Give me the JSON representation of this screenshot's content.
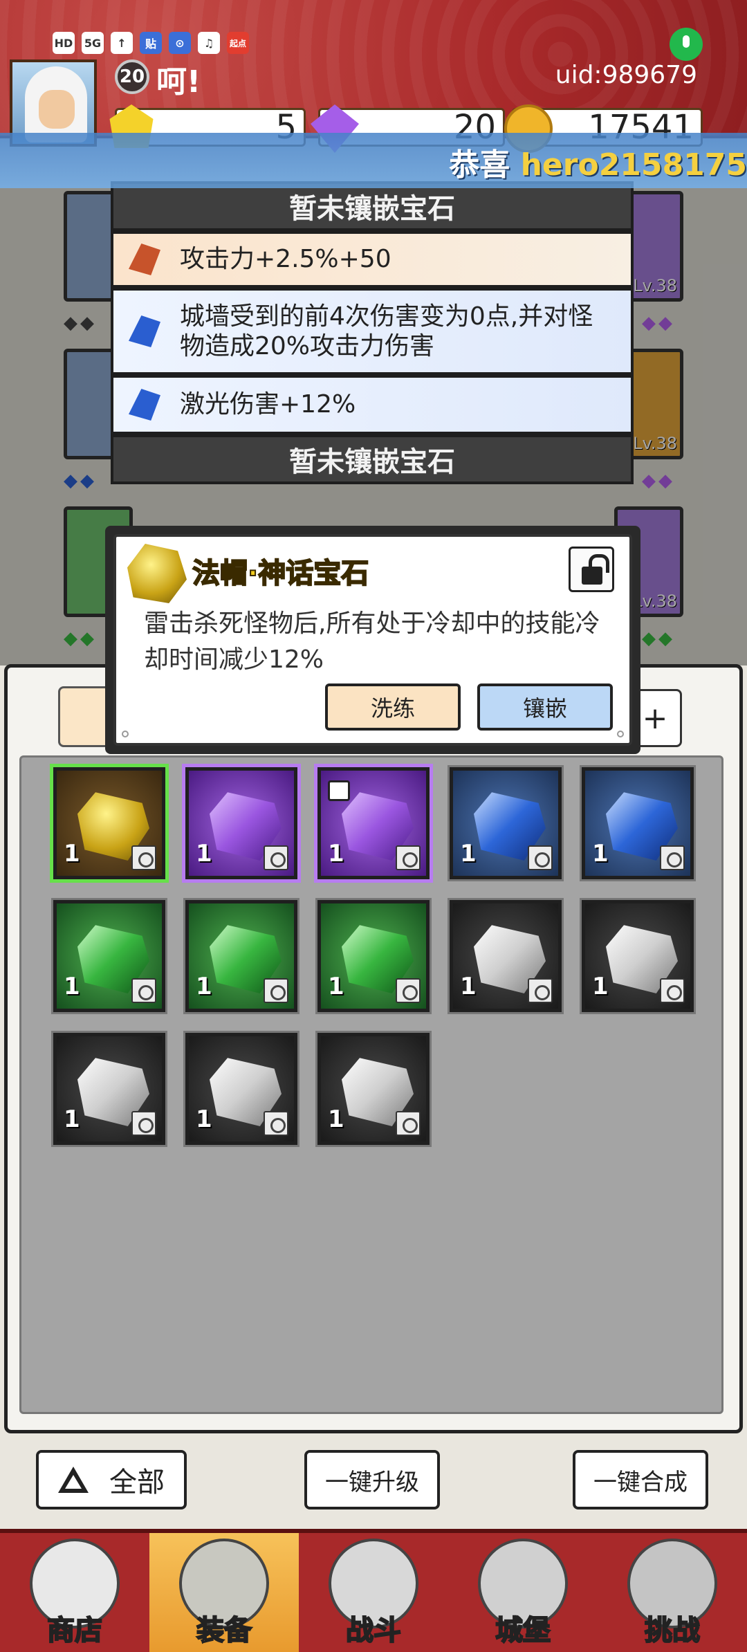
{
  "header": {
    "level": "20",
    "player_name": "呵!",
    "uid": "uid:989679",
    "status_icons": [
      "HD",
      "5G",
      "↑",
      "贴",
      "⊙",
      "♫",
      "起点"
    ],
    "resources": [
      {
        "icon": "yellow-gem-icon",
        "value": "5"
      },
      {
        "icon": "purple-diamond-icon",
        "value": "20"
      },
      {
        "icon": "gold-coin-icon",
        "value": "17541"
      }
    ]
  },
  "banner": {
    "prefix": "恭喜 ",
    "highlight": "hero2158175"
  },
  "equipment_bg": {
    "levels": [
      "Lv.38",
      "Lv.38",
      "Lv.38"
    ]
  },
  "gem_slots": [
    {
      "type": "empty",
      "label": "暂未镶嵌宝石"
    },
    {
      "type": "filled",
      "color": "orange",
      "text": "攻击力+2.5%+50"
    },
    {
      "type": "filled",
      "color": "blue",
      "text": "城墙受到的前4次伤害变为0点,并对怪物造成20%攻击力伤害"
    },
    {
      "type": "filled",
      "color": "blue",
      "text": "激光伤害+12%"
    },
    {
      "type": "empty",
      "label": "暂未镶嵌宝石"
    }
  ],
  "popup": {
    "title": "法帽·神话宝石",
    "description": "雷击杀死怪物后,所有处于冷却中的技能冷却时间减少12%",
    "refine_label": "洗练",
    "inlay_label": "镶嵌"
  },
  "inventory": {
    "plus_label": "+",
    "items": [
      {
        "tier": "mythic",
        "count": "1",
        "slot": "hat",
        "selected": "green"
      },
      {
        "tier": "purple",
        "count": "1",
        "slot": "hat",
        "selected": "purple"
      },
      {
        "tier": "purple",
        "count": "1",
        "slot": "armor",
        "selected": "purple",
        "locked": true
      },
      {
        "tier": "blue",
        "count": "1",
        "slot": "weapon"
      },
      {
        "tier": "blue",
        "count": "1",
        "slot": "armor"
      },
      {
        "tier": "green",
        "count": "1",
        "slot": "hat"
      },
      {
        "tier": "green",
        "count": "1",
        "slot": "boots"
      },
      {
        "tier": "green",
        "count": "1",
        "slot": "weapon"
      },
      {
        "tier": "gray",
        "count": "1",
        "slot": "hat"
      },
      {
        "tier": "gray",
        "count": "1",
        "slot": "gloves"
      },
      {
        "tier": "gray",
        "count": "1",
        "slot": "boots"
      },
      {
        "tier": "gray",
        "count": "1",
        "slot": "weapon"
      },
      {
        "tier": "gray",
        "count": "1",
        "slot": "armor"
      }
    ]
  },
  "actions": {
    "all_label": "全部",
    "upgrade_label": "一键升级",
    "merge_label": "一键合成"
  },
  "nav": [
    {
      "label": "商店",
      "icon": "shop-icon"
    },
    {
      "label": "装备",
      "icon": "bag-icon",
      "active": true
    },
    {
      "label": "战斗",
      "icon": "crossed-swords-icon"
    },
    {
      "label": "城堡",
      "icon": "castle-icon"
    },
    {
      "label": "挑战",
      "icon": "shield-icon"
    }
  ]
}
